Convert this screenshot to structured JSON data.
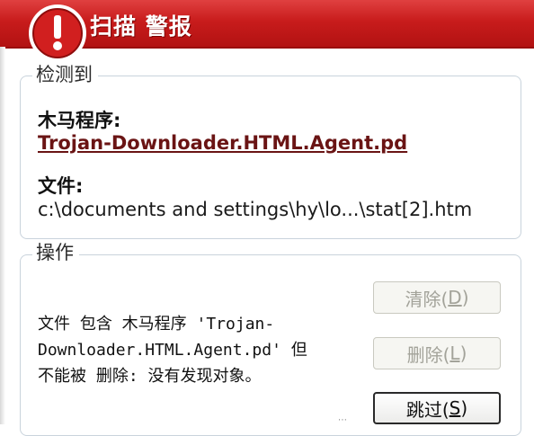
{
  "window": {
    "title": "扫描 警报",
    "icon": "alert-icon",
    "accent_color": "#c81c1c"
  },
  "detected": {
    "group_label": "检测到",
    "trojan_label": "木马程序:",
    "trojan_name": "Trojan-Downloader.HTML.Agent.pd",
    "file_label": "文件:",
    "file_path": "c:\\documents and settings\\hy\\lo...\\stat[2].htm"
  },
  "action": {
    "group_label": "操作",
    "message_lines": [
      "文件 包含 木马程序 'Trojan-",
      "Downloader.HTML.Agent.pd' 但",
      "不能被 删除: 没有发现对象。"
    ],
    "buttons": {
      "clean": {
        "text": "清除(",
        "key": "D",
        "end": ")",
        "enabled": false
      },
      "delete": {
        "text": "删除(",
        "key": "L",
        "end": ")",
        "enabled": false
      },
      "skip": {
        "text": "跳过(",
        "key": "S",
        "end": ")",
        "enabled": true
      }
    }
  }
}
